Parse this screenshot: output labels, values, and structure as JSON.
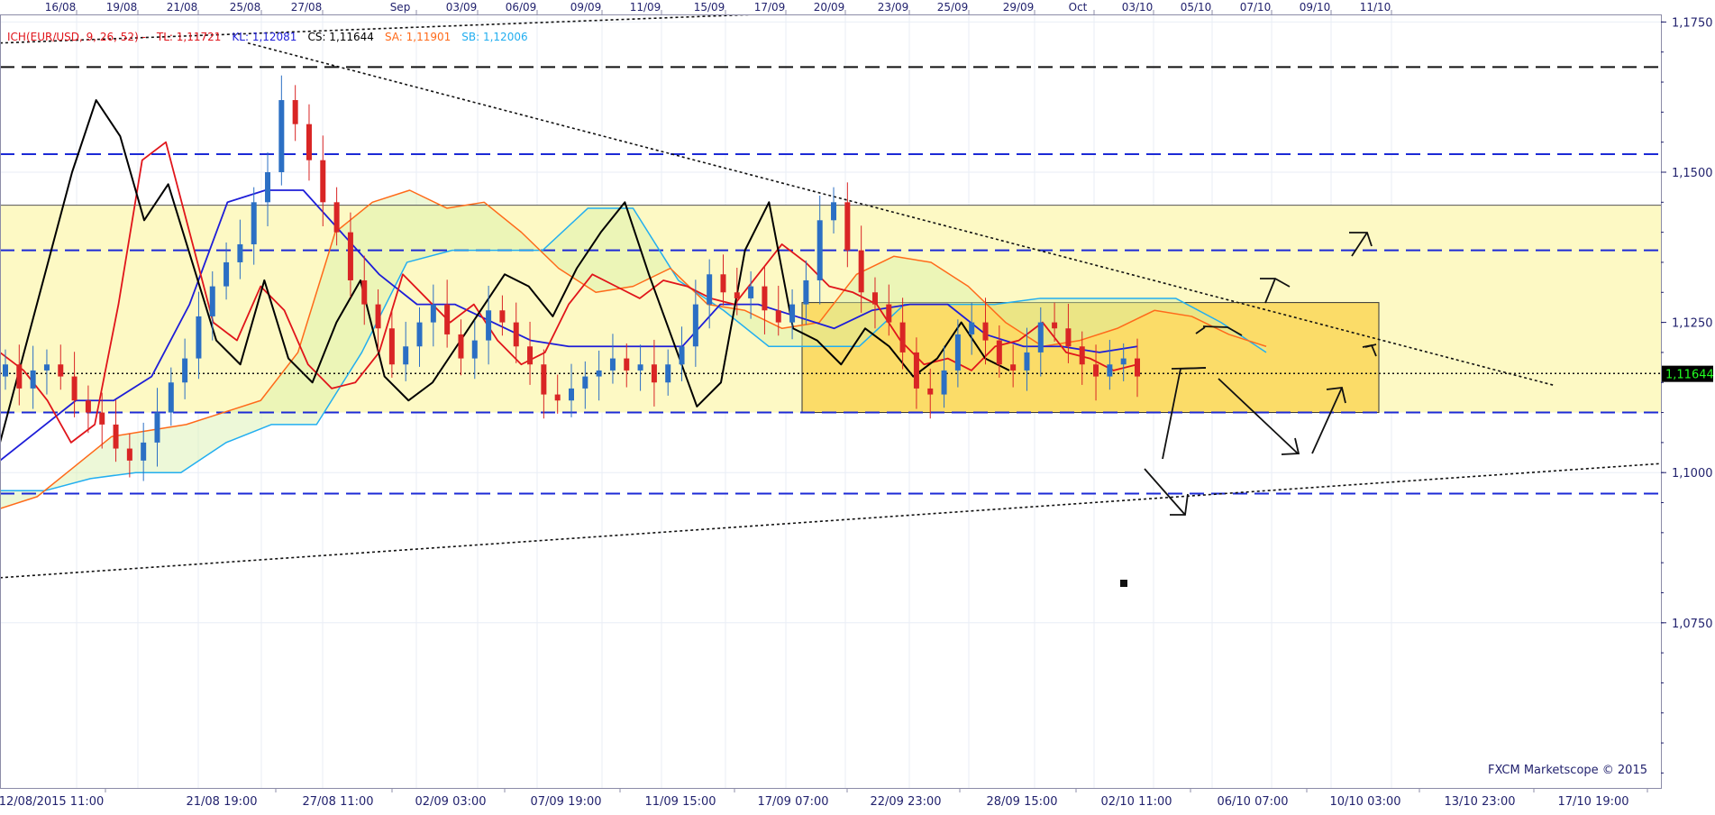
{
  "chart_data": {
    "type": "candlestick",
    "instrument": "EUR/USD",
    "indicator_legend": [
      {
        "text": "ICH(EUR/USD, 9, 26, 52) -",
        "color": "#e0151b"
      },
      {
        "text": "TL: 1,11721",
        "color": "#e0151b"
      },
      {
        "text": "KL: 1,12081",
        "color": "#1e1ed8"
      },
      {
        "text": "CS: 1,11644",
        "color": "#000000"
      },
      {
        "text": "SA: 1,11901",
        "color": "#ff6a1a"
      },
      {
        "text": "SB: 1,12006",
        "color": "#22aef0"
      }
    ],
    "top_axis_labels": [
      "16/08",
      "19/08",
      "21/08",
      "25/08",
      "27/08",
      "Sep",
      "03/09",
      "06/09",
      "09/09",
      "11/09",
      "15/09",
      "17/09",
      "20/09",
      "23/09",
      "25/09",
      "29/09",
      "Oct",
      "03/10",
      "05/10",
      "07/10",
      "09/10",
      "11/10"
    ],
    "bottom_axis_labels": [
      "12/08/2015 11:00",
      "21/08 19:00",
      "27/08 11:00",
      "02/09 03:00",
      "07/09 19:00",
      "11/09 15:00",
      "17/09 07:00",
      "22/09 23:00",
      "28/09 15:00",
      "02/10 11:00",
      "06/10 07:00",
      "10/10 03:00",
      "13/10 23:00",
      "17/10 19:00"
    ],
    "y_axis_labels": [
      "1,1750",
      "1,1500",
      "1,1250",
      "1,1000",
      "1,0750"
    ],
    "ylim": [
      1.05,
      1.182
    ],
    "current_price": "1,11644",
    "watermark": "FXCM Marketscope © 2015",
    "series": [
      {
        "name": "Price",
        "values": [
          1.118,
          1.114,
          1.117,
          1.118,
          1.116,
          1.112,
          1.11,
          1.108,
          1.104,
          1.102,
          1.105,
          1.11,
          1.115,
          1.119,
          1.126,
          1.131,
          1.135,
          1.138,
          1.145,
          1.15,
          1.162,
          1.158,
          1.152,
          1.145,
          1.14,
          1.132,
          1.128,
          1.124,
          1.118,
          1.121,
          1.125,
          1.128,
          1.123,
          1.119,
          1.122,
          1.127,
          1.125,
          1.121,
          1.118,
          1.113,
          1.112,
          1.114,
          1.116,
          1.117,
          1.119,
          1.117,
          1.118,
          1.115,
          1.118,
          1.121,
          1.128,
          1.133,
          1.13,
          1.129,
          1.131,
          1.127,
          1.125,
          1.128,
          1.132,
          1.142,
          1.145,
          1.137,
          1.13,
          1.128,
          1.125,
          1.12,
          1.114,
          1.113,
          1.117,
          1.123,
          1.125,
          1.122,
          1.118,
          1.117,
          1.12,
          1.125,
          1.124,
          1.121,
          1.118,
          1.116,
          1.118,
          1.119,
          1.116
        ]
      },
      {
        "name": "TL",
        "values": [
          1.12,
          1.117,
          1.112,
          1.105,
          1.108,
          1.128,
          1.152,
          1.155,
          1.14,
          1.125,
          1.122,
          1.131,
          1.127,
          1.118,
          1.114,
          1.115,
          1.12,
          1.133,
          1.129,
          1.125,
          1.128,
          1.122,
          1.118,
          1.12,
          1.128,
          1.133,
          1.131,
          1.129,
          1.132,
          1.131,
          1.129,
          1.128,
          1.133,
          1.138,
          1.135,
          1.131,
          1.13,
          1.128,
          1.122,
          1.118,
          1.119,
          1.117,
          1.121,
          1.122,
          1.125,
          1.12,
          1.119,
          1.117,
          1.118
        ]
      },
      {
        "name": "KL",
        "values": [
          1.102,
          1.107,
          1.112,
          1.112,
          1.116,
          1.128,
          1.145,
          1.147,
          1.147,
          1.14,
          1.133,
          1.128,
          1.128,
          1.125,
          1.122,
          1.121,
          1.121,
          1.121,
          1.121,
          1.128,
          1.128,
          1.126,
          1.124,
          1.127,
          1.128,
          1.128,
          1.123,
          1.121,
          1.121,
          1.12,
          1.121
        ]
      },
      {
        "name": "CS",
        "values": [
          1.105,
          1.12,
          1.135,
          1.15,
          1.162,
          1.156,
          1.142,
          1.148,
          1.135,
          1.122,
          1.118,
          1.132,
          1.119,
          1.115,
          1.125,
          1.132,
          1.116,
          1.112,
          1.115,
          1.121,
          1.127,
          1.133,
          1.131,
          1.126,
          1.134,
          1.14,
          1.145,
          1.133,
          1.122,
          1.111,
          1.115,
          1.137,
          1.145,
          1.124,
          1.122,
          1.118,
          1.124,
          1.121,
          1.116,
          1.119,
          1.125,
          1.119,
          1.117
        ]
      },
      {
        "name": "SA",
        "values": [
          1.094,
          1.096,
          1.101,
          1.106,
          1.107,
          1.108,
          1.11,
          1.112,
          1.12,
          1.14,
          1.145,
          1.147,
          1.144,
          1.145,
          1.14,
          1.134,
          1.13,
          1.131,
          1.134,
          1.128,
          1.127,
          1.124,
          1.125,
          1.133,
          1.136,
          1.135,
          1.131,
          1.125,
          1.121,
          1.122,
          1.124,
          1.127,
          1.126,
          1.123,
          1.121
        ]
      },
      {
        "name": "SB",
        "values": [
          1.097,
          1.097,
          1.099,
          1.1,
          1.1,
          1.105,
          1.108,
          1.108,
          1.12,
          1.135,
          1.137,
          1.137,
          1.137,
          1.144,
          1.144,
          1.132,
          1.127,
          1.121,
          1.121,
          1.121,
          1.128,
          1.128,
          1.128,
          1.129,
          1.129,
          1.129,
          1.129,
          1.125,
          1.12
        ]
      }
    ],
    "horizontal_levels": [
      {
        "value": 1.1675,
        "style": "black-dashed"
      },
      {
        "value": 1.153,
        "style": "blue-dashed"
      },
      {
        "value": 1.1445,
        "style": "gray-solid"
      },
      {
        "value": 1.137,
        "style": "blue-dashed"
      },
      {
        "value": 1.1165,
        "style": "dotted"
      },
      {
        "value": 1.11,
        "style": "blue-dashed"
      },
      {
        "value": 1.0965,
        "style": "blue-dashed"
      }
    ],
    "zones": [
      {
        "from": 1.11,
        "to": 1.1445,
        "color": "#fdf9c4"
      },
      {
        "from": 1.11,
        "to": 1.1283,
        "color": "#fbdc68"
      }
    ],
    "trendlines": [
      "upper-rising-dotted",
      "descending-dotted",
      "lower-rising-dotted"
    ],
    "projection_arrows": 7,
    "grid": true,
    "colors": {
      "bullish": "#2b6fc4",
      "bearish": "#d92525",
      "background": "#ffffff",
      "price_tag": "#00aa00"
    }
  }
}
